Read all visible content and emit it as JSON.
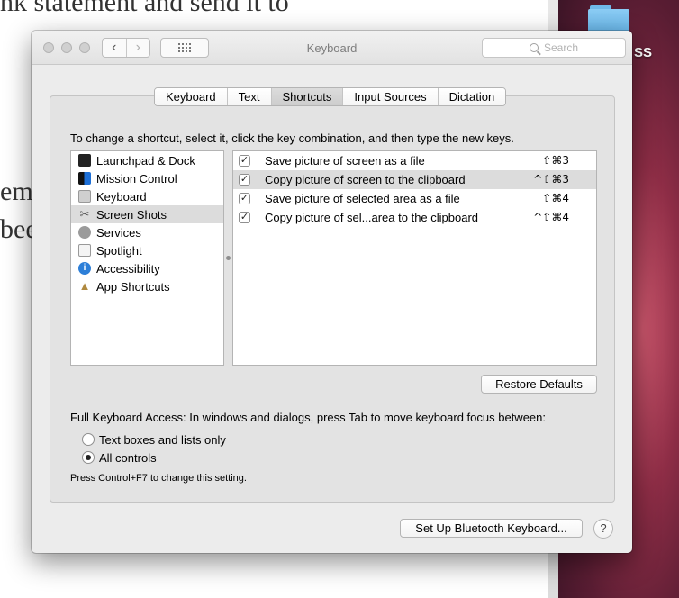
{
  "background": {
    "doc_lines": [
      "nk statement and send it to",
      "em",
      "bee"
    ],
    "desktop_label": "SS"
  },
  "window": {
    "title": "Keyboard",
    "search_placeholder": "Search",
    "nav_back": "‹",
    "nav_forward": "›"
  },
  "tabs": [
    {
      "label": "Keyboard",
      "active": false
    },
    {
      "label": "Text",
      "active": false
    },
    {
      "label": "Shortcuts",
      "active": true
    },
    {
      "label": "Input Sources",
      "active": false
    },
    {
      "label": "Dictation",
      "active": false
    }
  ],
  "instructions": "To change a shortcut, select it, click the key combination, and then type the new keys.",
  "categories": [
    {
      "label": "Launchpad & Dock",
      "icon": "launchpad-icon"
    },
    {
      "label": "Mission Control",
      "icon": "mission-control-icon"
    },
    {
      "label": "Keyboard",
      "icon": "keyboard-icon"
    },
    {
      "label": "Screen Shots",
      "icon": "screenshot-icon",
      "selected": true
    },
    {
      "label": "Services",
      "icon": "gear-icon"
    },
    {
      "label": "Spotlight",
      "icon": "spotlight-icon"
    },
    {
      "label": "Accessibility",
      "icon": "accessibility-icon"
    },
    {
      "label": "App Shortcuts",
      "icon": "app-shortcuts-icon"
    }
  ],
  "shortcuts": [
    {
      "checked": true,
      "label": "Save picture of screen as a file",
      "keys": "⇧⌘3"
    },
    {
      "checked": true,
      "label": "Copy picture of screen to the clipboard",
      "keys": "^⇧⌘3",
      "selected": true
    },
    {
      "checked": true,
      "label": "Save picture of selected area as a file",
      "keys": "⇧⌘4"
    },
    {
      "checked": true,
      "label": "Copy picture of sel...area to the clipboard",
      "keys": "^⇧⌘4"
    }
  ],
  "restore_defaults": "Restore Defaults",
  "full_keyboard_access": {
    "label": "Full Keyboard Access: In windows and dialogs, press Tab to move keyboard focus between:",
    "options": [
      {
        "label": "Text boxes and lists only",
        "selected": false
      },
      {
        "label": "All controls",
        "selected": true
      }
    ],
    "hint": "Press Control+F7 to change this setting."
  },
  "bluetooth_button": "Set Up Bluetooth Keyboard...",
  "help_button": "?"
}
